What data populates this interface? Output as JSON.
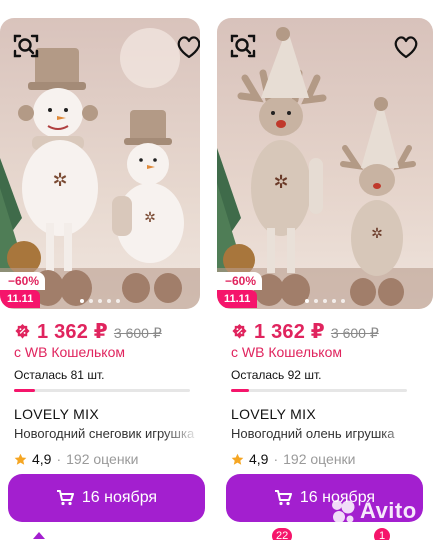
{
  "products": [
    {
      "discount": "−60%",
      "promo_date": "11.11",
      "price": "1 362 ₽",
      "old_price": "3 600 ₽",
      "wallet_text": "с WB Кошельком",
      "stock": "Осталась 81 шт.",
      "stock_level": 0.12,
      "brand": "LOVELY MIX",
      "title": "Новогодний снеговик игрушка",
      "rating": "4,9",
      "rating_sep": "·",
      "reviews": "192 оценки",
      "cta": "16 ноября",
      "icons": {
        "search": "image-search-icon",
        "favorite": "heart-icon",
        "price": "discount-percent-icon",
        "star": "star-icon",
        "cart": "cart-icon"
      }
    },
    {
      "discount": "−60%",
      "promo_date": "11.11",
      "price": "1 362 ₽",
      "old_price": "3 600 ₽",
      "wallet_text": "с WB Кошельком",
      "stock": "Осталась 92 шт.",
      "stock_level": 0.1,
      "brand": "LOVELY MIX",
      "title": "Новогодний олень игрушка",
      "rating": "4,9",
      "rating_sep": "·",
      "reviews": "192 оценки",
      "cta": "16 ноября",
      "icons": {
        "search": "image-search-icon",
        "favorite": "heart-icon",
        "price": "discount-percent-icon",
        "star": "star-icon",
        "cart": "cart-icon"
      }
    }
  ],
  "tabbar": {
    "cart_badge": "22",
    "profile_badge": "1"
  },
  "watermark": {
    "text": "Avito"
  },
  "colors": {
    "accent": "#a31fcf",
    "price": "#e0245e",
    "promo": "#f5156b",
    "star": "#f5a623"
  }
}
